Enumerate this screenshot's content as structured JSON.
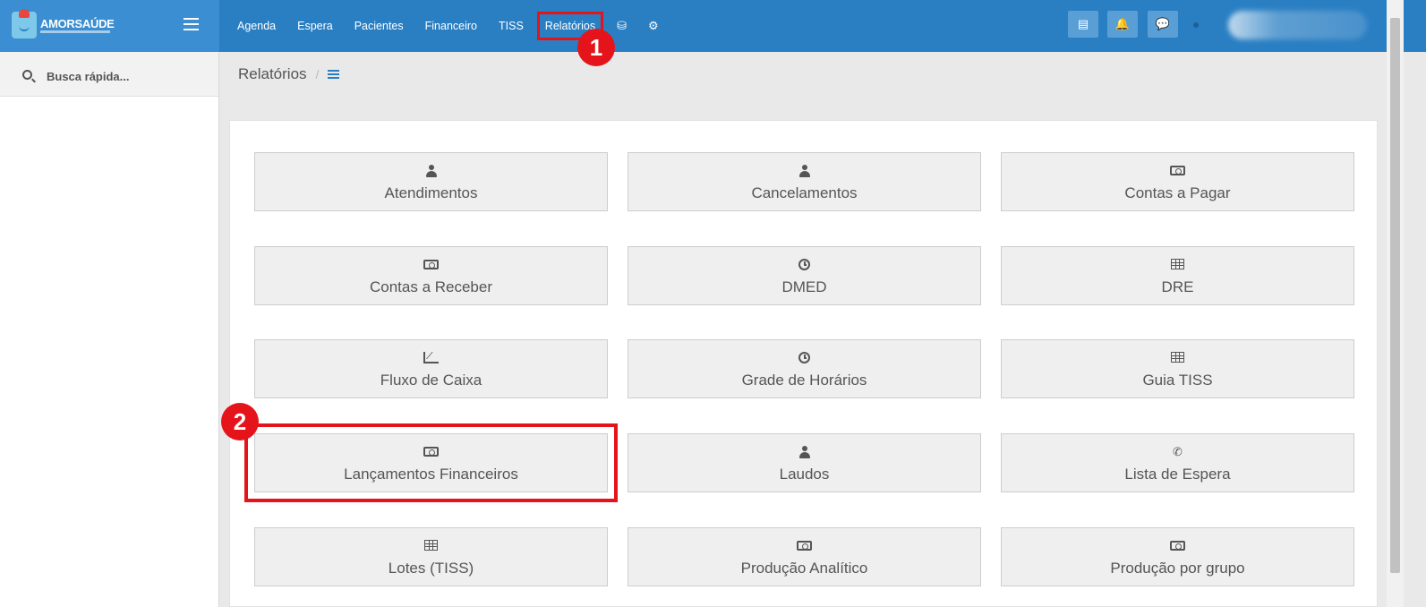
{
  "brand": {
    "name": "AMORSAÚDE"
  },
  "nav": {
    "items": [
      "Agenda",
      "Espera",
      "Pacientes",
      "Financeiro",
      "TISS",
      "Relatórios"
    ],
    "active": "Relatórios"
  },
  "callouts": {
    "first": "1",
    "second": "2"
  },
  "search": {
    "placeholder": "Busca rápida..."
  },
  "breadcrumb": {
    "title": "Relatórios",
    "separator": "/"
  },
  "reports": [
    {
      "label": "Atendimentos",
      "icon": "user-doctor-icon"
    },
    {
      "label": "Cancelamentos",
      "icon": "user-doctor-icon"
    },
    {
      "label": "Contas a Pagar",
      "icon": "money-icon"
    },
    {
      "label": "Contas a Receber",
      "icon": "money-icon"
    },
    {
      "label": "DMED",
      "icon": "clock-icon"
    },
    {
      "label": "DRE",
      "icon": "table-icon"
    },
    {
      "label": "Fluxo de Caixa",
      "icon": "line-chart-icon"
    },
    {
      "label": "Grade de Horários",
      "icon": "clock-icon"
    },
    {
      "label": "Guia TISS",
      "icon": "table-icon"
    },
    {
      "label": "Lançamentos Financeiros",
      "icon": "money-icon"
    },
    {
      "label": "Laudos",
      "icon": "user-doctor-icon"
    },
    {
      "label": "Lista de Espera",
      "icon": "phone-icon"
    },
    {
      "label": "Lotes (TISS)",
      "icon": "table-icon"
    },
    {
      "label": "Produção Analítico",
      "icon": "money-icon"
    },
    {
      "label": "Produção por grupo",
      "icon": "money-icon"
    }
  ],
  "colors": {
    "topbar": "#2a7fc3",
    "highlight": "#e4141a",
    "button_bg": "#efefef"
  }
}
